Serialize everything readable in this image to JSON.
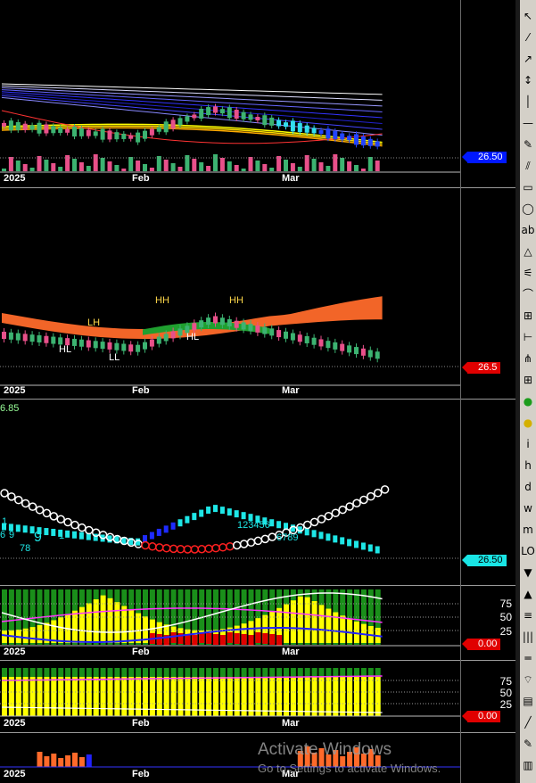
{
  "colors": {
    "background": "#000000",
    "up_candle": "#3cb371",
    "down_candle": "#e8508a",
    "price_tag_blue": "#0018ff",
    "price_tag_red": "#e00000",
    "price_tag_cyan": "#19e5e5",
    "stoch_yellow": "#ffff00",
    "stoch_green": "#1a8f1a",
    "stoch_red": "#e00000",
    "magenta_line": "#ff33ff",
    "white_line": "#ffffff",
    "blue_line": "#2020ff"
  },
  "time_axis": {
    "labels": [
      "2025",
      "Feb",
      "Mar"
    ]
  },
  "panels": {
    "price": {
      "tag": "26.50"
    },
    "wave": {
      "tag": "26.5",
      "annotations": {
        "hh1": "HH",
        "hh2": "HH",
        "lh": "LH",
        "hl1": "HL",
        "hl2": "HL",
        "ll": "LL"
      }
    },
    "dots": {
      "top_value": "6.85",
      "tag": "26.50",
      "counts": {
        "c1": "1",
        "c2": "9",
        "c3": "6",
        "c4": "78",
        "c5": "9",
        "c6": "1",
        "c7": "123456",
        "c8": "6789"
      }
    },
    "stoch1": {
      "levels": [
        "75",
        "50",
        "25"
      ],
      "tag": "0.00"
    },
    "stoch2": {
      "levels": [
        "75",
        "50",
        "25"
      ],
      "tag": "0.00"
    },
    "hist": {}
  },
  "toolbar": {
    "icons": [
      "cursor-icon",
      "line-icon",
      "ray-icon",
      "arrow-icon",
      "vertical-line-icon",
      "hline-icon",
      "pen-icon",
      "channel-icon",
      "rectangle-icon",
      "ellipse-icon",
      "text-icon",
      "triangle-icon",
      "fib-icon",
      "arc-icon",
      "gann-icon",
      "cycle-icon",
      "pitchfork-icon",
      "grid-icon",
      "green-circle-icon",
      "yellow-circle-icon",
      "italic-icon",
      "hw-icon",
      "d-icon",
      "ww-icon",
      "mm-icon",
      "lo-icon",
      "triangle-down-icon",
      "triangle-up-icon",
      "list-icon",
      "bars-icon",
      "hbars-icon",
      "fan-icon",
      "table-icon",
      "line2-icon",
      "edit-icon",
      "hist-icon"
    ]
  },
  "watermark": {
    "line1": "Activate Windows",
    "line2": "Go to Settings to activate Windows."
  }
}
